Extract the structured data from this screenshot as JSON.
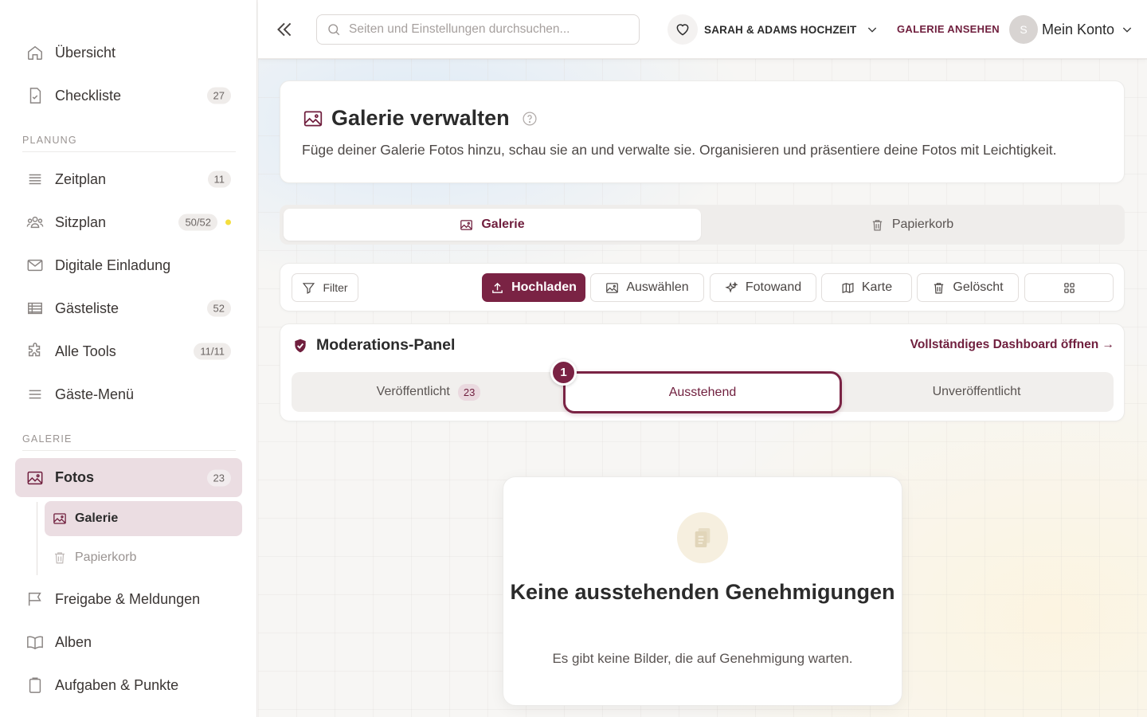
{
  "sidebar": {
    "items_top": [
      {
        "label": "Übersicht",
        "icon": "home-icon"
      },
      {
        "label": "Checkliste",
        "icon": "checklist-icon",
        "badge": "27"
      }
    ],
    "section_planung": "PLANUNG",
    "items_planung": [
      {
        "label": "Zeitplan",
        "icon": "timeline-icon",
        "badge": "11"
      },
      {
        "label": "Sitzplan",
        "icon": "people-icon",
        "badge": "50/52"
      },
      {
        "label": "Digitale Einladung",
        "icon": "mail-icon"
      },
      {
        "label": "Gästeliste",
        "icon": "table-icon",
        "badge": "52"
      },
      {
        "label": "Alle Tools",
        "icon": "puzzle-icon",
        "badge": "11/11"
      },
      {
        "label": "Gäste-Menü",
        "icon": "menu-icon"
      }
    ],
    "section_galerie": "GALERIE",
    "fotos": {
      "label": "Fotos",
      "badge": "23"
    },
    "sub_items": [
      {
        "label": "Galerie"
      },
      {
        "label": "Papierkorb"
      }
    ],
    "items_bottom": [
      {
        "label": "Freigabe & Meldungen"
      },
      {
        "label": "Alben"
      },
      {
        "label": "Aufgaben & Punkte"
      }
    ]
  },
  "topbar": {
    "search_placeholder": "Seiten und Einstellungen durchsuchen...",
    "event_name": "SARAH & ADAMS HOCHZEIT",
    "view_gallery": "GALERIE ANSEHEN",
    "avatar_initial": "S",
    "account_label": "Mein Konto"
  },
  "header": {
    "title": "Galerie verwalten",
    "description": "Füge deiner Galerie Fotos hinzu, schau sie an und verwalte sie. Organisieren und präsentiere deine Fotos mit Leichtigkeit."
  },
  "tabs": [
    {
      "label": "Galerie",
      "active": true
    },
    {
      "label": "Papierkorb",
      "active": false
    }
  ],
  "toolbar": {
    "filter": "Filter",
    "upload": "Hochladen",
    "select": "Auswählen",
    "photowall": "Fotowand",
    "map": "Karte",
    "deleted": "Gelöscht"
  },
  "moderation": {
    "title": "Moderations-Panel",
    "dashboard_link": "Vollständiges Dashboard öffnen →",
    "step": "1",
    "tabs": [
      {
        "label": "Veröffentlicht",
        "count": "23"
      },
      {
        "label": "Ausstehend"
      },
      {
        "label": "Unveröffentlicht"
      }
    ]
  },
  "empty_state": {
    "title": "Keine ausstehenden Genehmigungen",
    "description": "Es gibt keine Bilder, die auf Genehmigung warten."
  },
  "colors": {
    "accent": "#7a2344",
    "active_bg": "#ebdde2",
    "status_dot": "#f4de3e"
  }
}
